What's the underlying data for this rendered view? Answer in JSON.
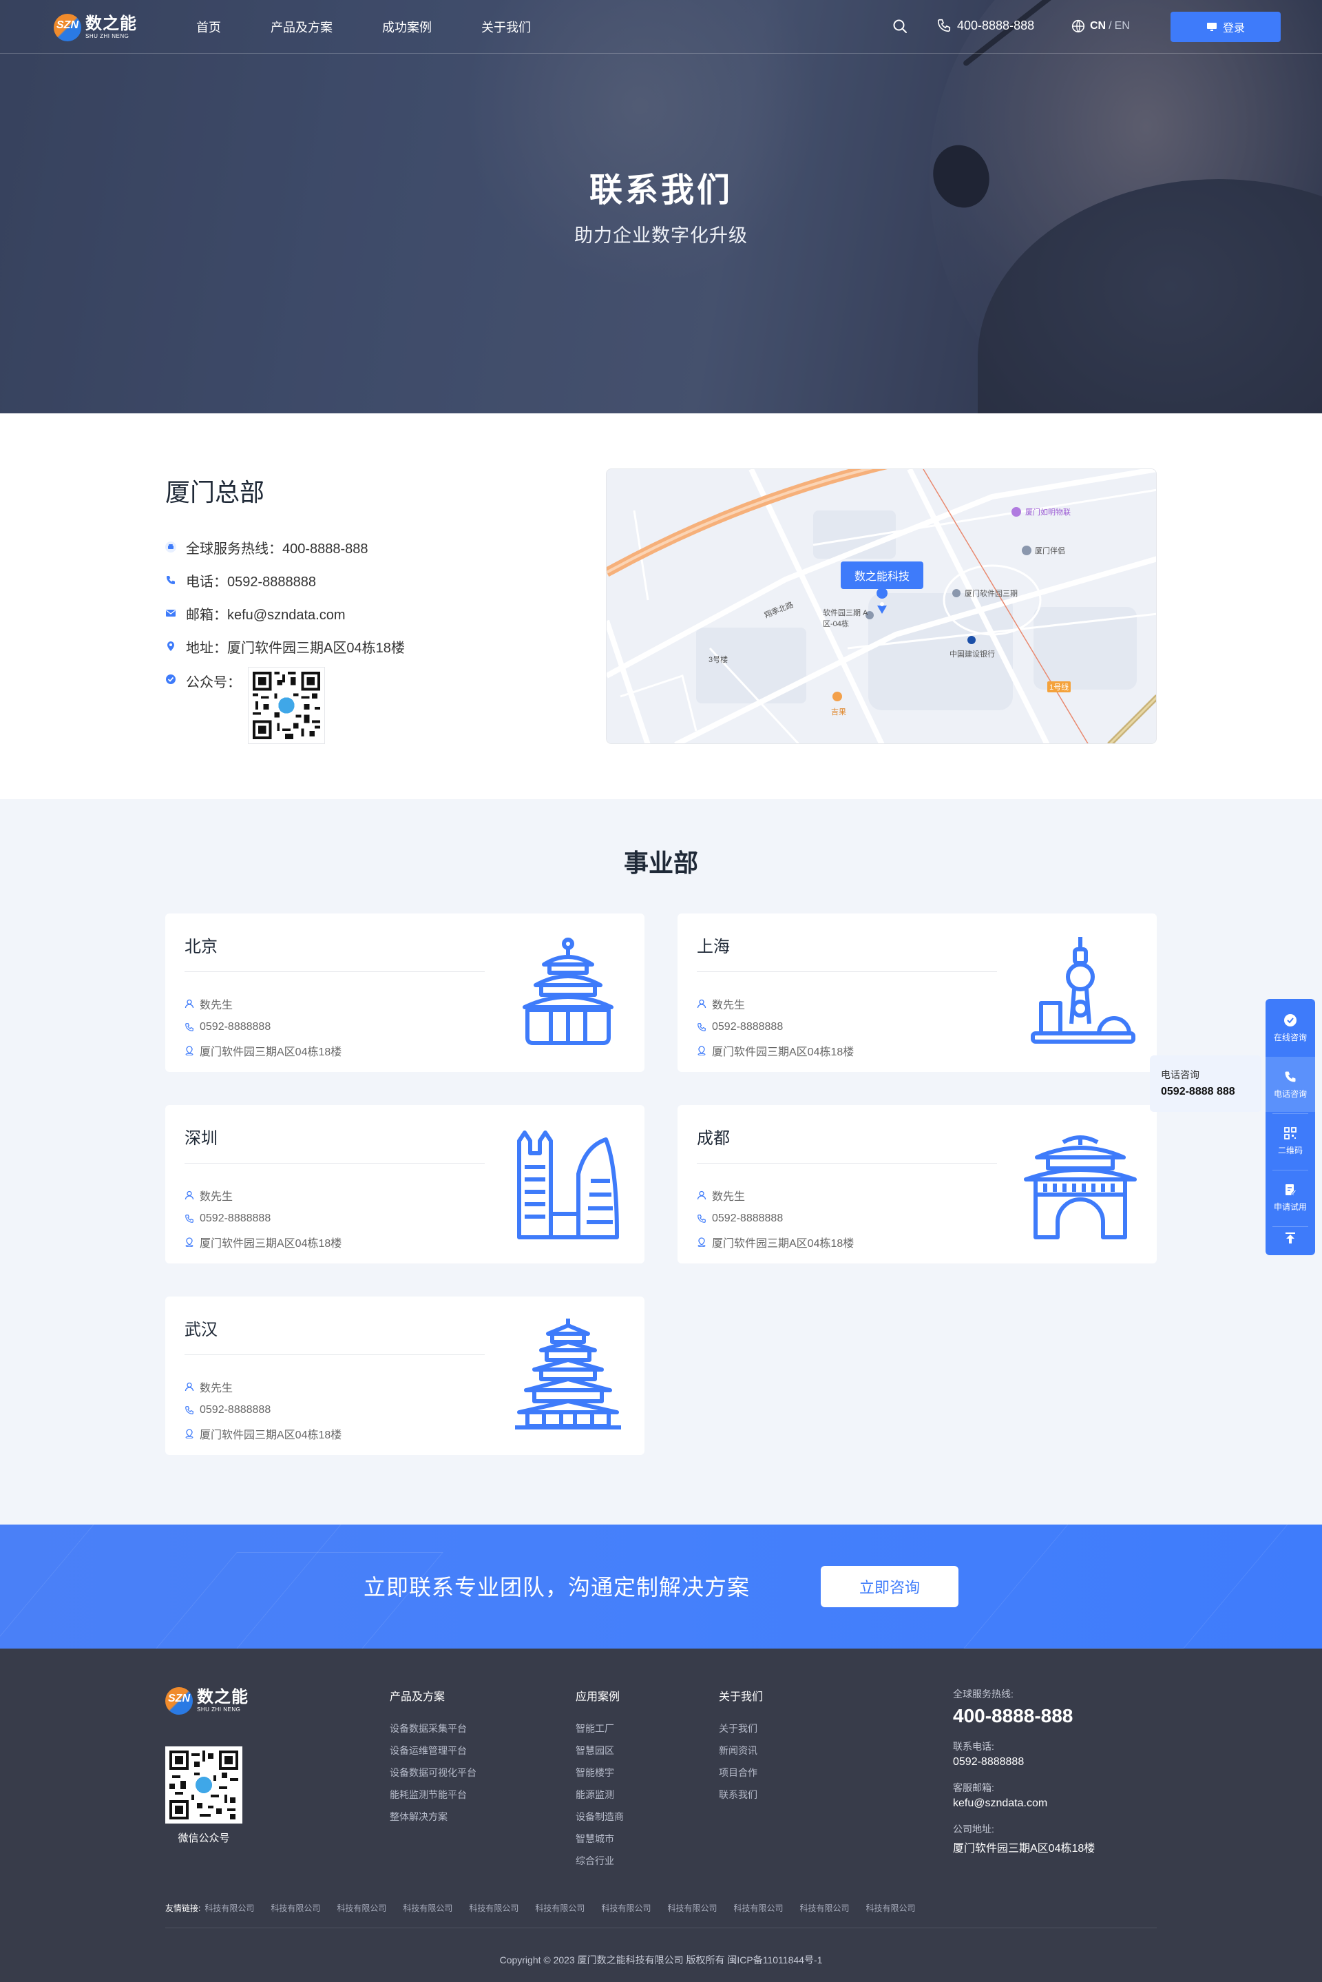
{
  "header": {
    "logo_cn": "数之能",
    "logo_en": "SHU ZHI NENG",
    "logo_mark": "SZN",
    "nav": [
      "首页",
      "产品及方案",
      "成功案例",
      "关于我们"
    ],
    "phone": "400-8888-888",
    "lang_cn": "CN",
    "lang_sep": "/",
    "lang_en": "EN",
    "login": "登录"
  },
  "hero": {
    "title": "联系我们",
    "subtitle": "助力企业数字化升级"
  },
  "hq": {
    "title": "厦门总部",
    "hotline": "全球服务热线：400-8888-888",
    "tel": "电话：0592-8888888",
    "email": "邮箱：kefu@szndata.com",
    "address": "地址：厦门软件园三期A区04栋18楼",
    "wechat": "公众号："
  },
  "map": {
    "tag": "数之能科技",
    "labels": [
      "厦门如明物联",
      "厦门伴侣",
      "厦门软件园三期",
      "软件园三期 A区-04栋",
      "中国建设银行",
      "翔季北路",
      "3号楼",
      "吉果",
      "1号线"
    ]
  },
  "divisions": {
    "title": "事业部",
    "cards": [
      {
        "city": "北京",
        "contact": "数先生",
        "phone": "0592-8888888",
        "address": "厦门软件园三期A区04栋18楼",
        "icon": "temple-of-heaven-icon"
      },
      {
        "city": "上海",
        "contact": "数先生",
        "phone": "0592-8888888",
        "address": "厦门软件园三期A区04栋18楼",
        "icon": "oriental-pearl-tower-icon"
      },
      {
        "city": "深圳",
        "contact": "数先生",
        "phone": "0592-8888888",
        "address": "厦门软件园三期A区04栋18楼",
        "icon": "skyscrapers-icon"
      },
      {
        "city": "成都",
        "contact": "数先生",
        "phone": "0592-8888888",
        "address": "厦门软件园三期A区04栋18楼",
        "icon": "city-gate-icon"
      },
      {
        "city": "武汉",
        "contact": "数先生",
        "phone": "0592-8888888",
        "address": "厦门软件园三期A区04栋18楼",
        "icon": "yellow-crane-tower-icon"
      }
    ]
  },
  "side": {
    "items": [
      "在线咨询",
      "电话咨询",
      "二维码",
      "申请试用"
    ],
    "popup_title": "电话咨询",
    "popup_value": "0592-8888 888"
  },
  "cta": {
    "text": "立即联系专业团队，沟通定制解决方案",
    "button": "立即咨询"
  },
  "footer": {
    "qr_label": "微信公众号",
    "cols": [
      {
        "title": "产品及方案",
        "items": [
          "设备数据采集平台",
          "设备运维管理平台",
          "设备数据可视化平台",
          "能耗监测节能平台",
          "整体解决方案"
        ]
      },
      {
        "title": "应用案例",
        "items": [
          "智能工厂",
          "智慧园区",
          "智能楼宇",
          "能源监测",
          "设备制造商",
          "智慧城市",
          "综合行业"
        ]
      },
      {
        "title": "关于我们",
        "items": [
          "关于我们",
          "新闻资讯",
          "项目合作",
          "联系我们"
        ]
      }
    ],
    "hotline_label": "全球服务热线:",
    "hotline": "400-8888-888",
    "tel_label": "联系电话:",
    "tel": "0592-8888888",
    "email_label": "客服邮箱:",
    "email": "kefu@szndata.com",
    "addr_label": "公司地址:",
    "addr": "厦门软件园三期A区04栋18楼",
    "friend_label": "友情链接:",
    "friends": [
      "科技有限公司",
      "科技有限公司",
      "科技有限公司",
      "科技有限公司",
      "科技有限公司",
      "科技有限公司",
      "科技有限公司",
      "科技有限公司",
      "科技有限公司",
      "科技有限公司",
      "科技有限公司"
    ],
    "copyright": "Copyright © 2023 厦门数之能科技有限公司 版权所有  闽ICP备11011844号-1"
  },
  "colors": {
    "accent": "#3e7bfa",
    "footer_bg": "#383c4a",
    "section_bg": "#f2f5fa"
  }
}
